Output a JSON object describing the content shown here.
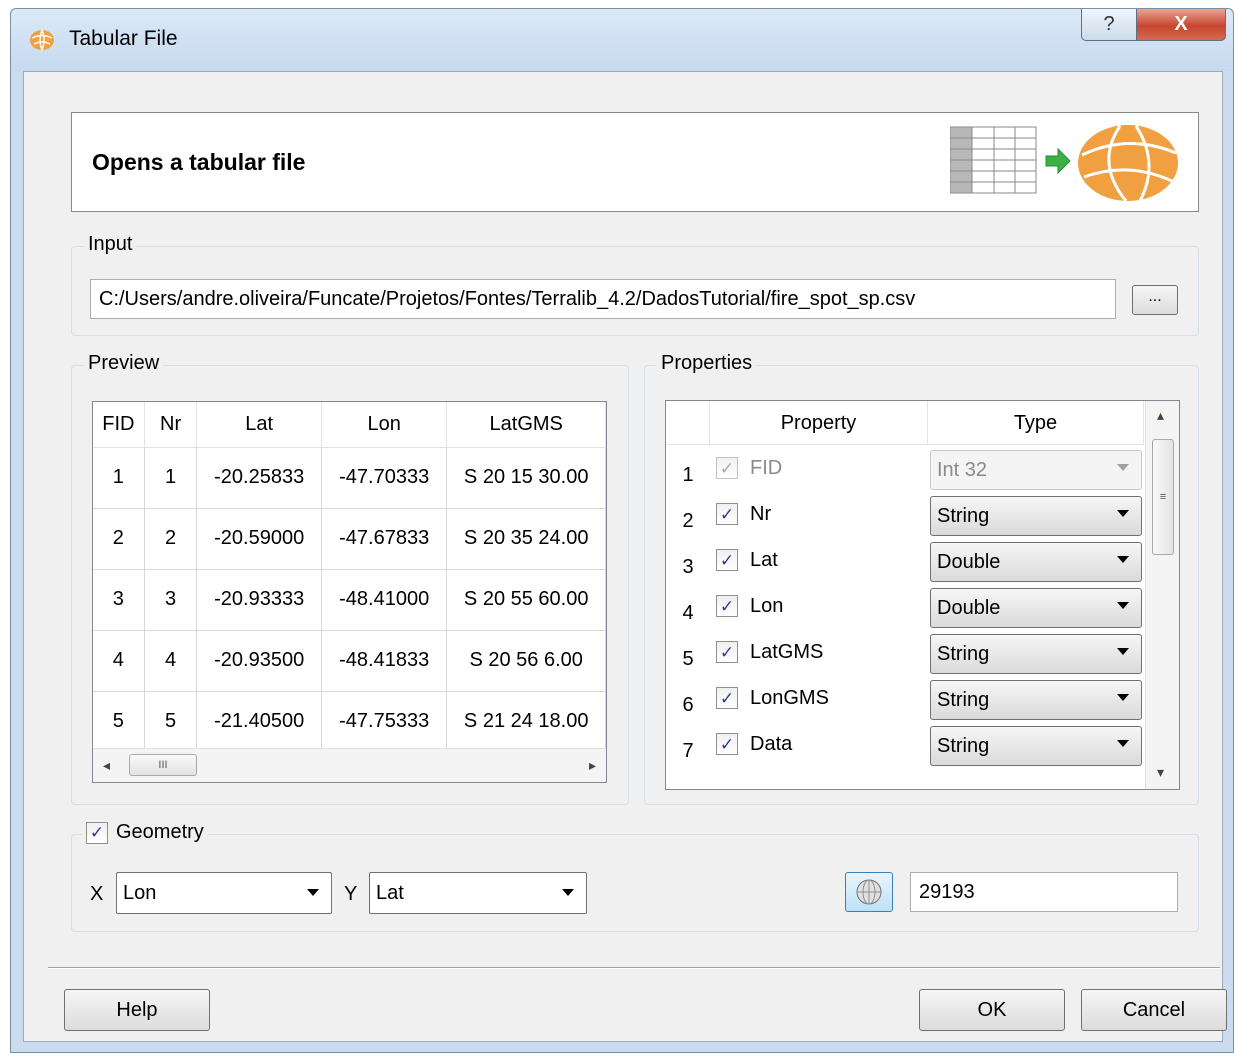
{
  "window": {
    "title": "Tabular File",
    "help_glyph": "?",
    "close_glyph": "X"
  },
  "header": {
    "title": "Opens a tabular file"
  },
  "input": {
    "group_label": "Input",
    "path": "C:/Users/andre.oliveira/Funcate/Projetos/Fontes/Terralib_4.2/DadosTutorial/fire_spot_sp.csv",
    "browse_label": "..."
  },
  "preview": {
    "group_label": "Preview",
    "columns": [
      "FID",
      "Nr",
      "Lat",
      "Lon",
      "LatGMS"
    ],
    "rows": [
      [
        "1",
        "1",
        "-20.25833",
        "-47.70333",
        "S 20 15 30.00"
      ],
      [
        "2",
        "2",
        "-20.59000",
        "-47.67833",
        "S 20 35 24.00"
      ],
      [
        "3",
        "3",
        "-20.93333",
        "-48.41000",
        "S 20 55 60.00"
      ],
      [
        "4",
        "4",
        "-20.93500",
        "-48.41833",
        "S 20 56 6.00"
      ],
      [
        "5",
        "5",
        "-21.40500",
        "-47.75333",
        "S 21 24 18.00"
      ]
    ],
    "scroll_left": "◂",
    "scroll_right": "▸",
    "scroll_grip": "III"
  },
  "properties": {
    "group_label": "Properties",
    "col_property": "Property",
    "col_type": "Type",
    "rows": [
      {
        "num": "1",
        "checked": true,
        "enabled": false,
        "name": "FID",
        "type": "Int 32"
      },
      {
        "num": "2",
        "checked": true,
        "enabled": true,
        "name": "Nr",
        "type": "String"
      },
      {
        "num": "3",
        "checked": true,
        "enabled": true,
        "name": "Lat",
        "type": "Double"
      },
      {
        "num": "4",
        "checked": true,
        "enabled": true,
        "name": "Lon",
        "type": "Double"
      },
      {
        "num": "5",
        "checked": true,
        "enabled": true,
        "name": "LatGMS",
        "type": "String"
      },
      {
        "num": "6",
        "checked": true,
        "enabled": true,
        "name": "LonGMS",
        "type": "String"
      },
      {
        "num": "7",
        "checked": true,
        "enabled": true,
        "name": "Data",
        "type": "String"
      }
    ],
    "check_glyph": "✓",
    "scroll_up": "▴",
    "scroll_down": "▾",
    "scroll_grip": "≡"
  },
  "geometry": {
    "label": "Geometry",
    "checked": true,
    "check_glyph": "✓",
    "x_label": "X",
    "x_value": "Lon",
    "y_label": "Y",
    "y_value": "Lat",
    "srid": "29193"
  },
  "footer": {
    "help": "Help",
    "ok": "OK",
    "cancel": "Cancel"
  },
  "colors": {
    "globe": "#f0a040",
    "arrow": "#3cb043",
    "titlebar": "#c9dcf0"
  },
  "icons": [
    "globe-icon",
    "table-icon",
    "arrow-right-icon",
    "srs-globe-icon"
  ]
}
